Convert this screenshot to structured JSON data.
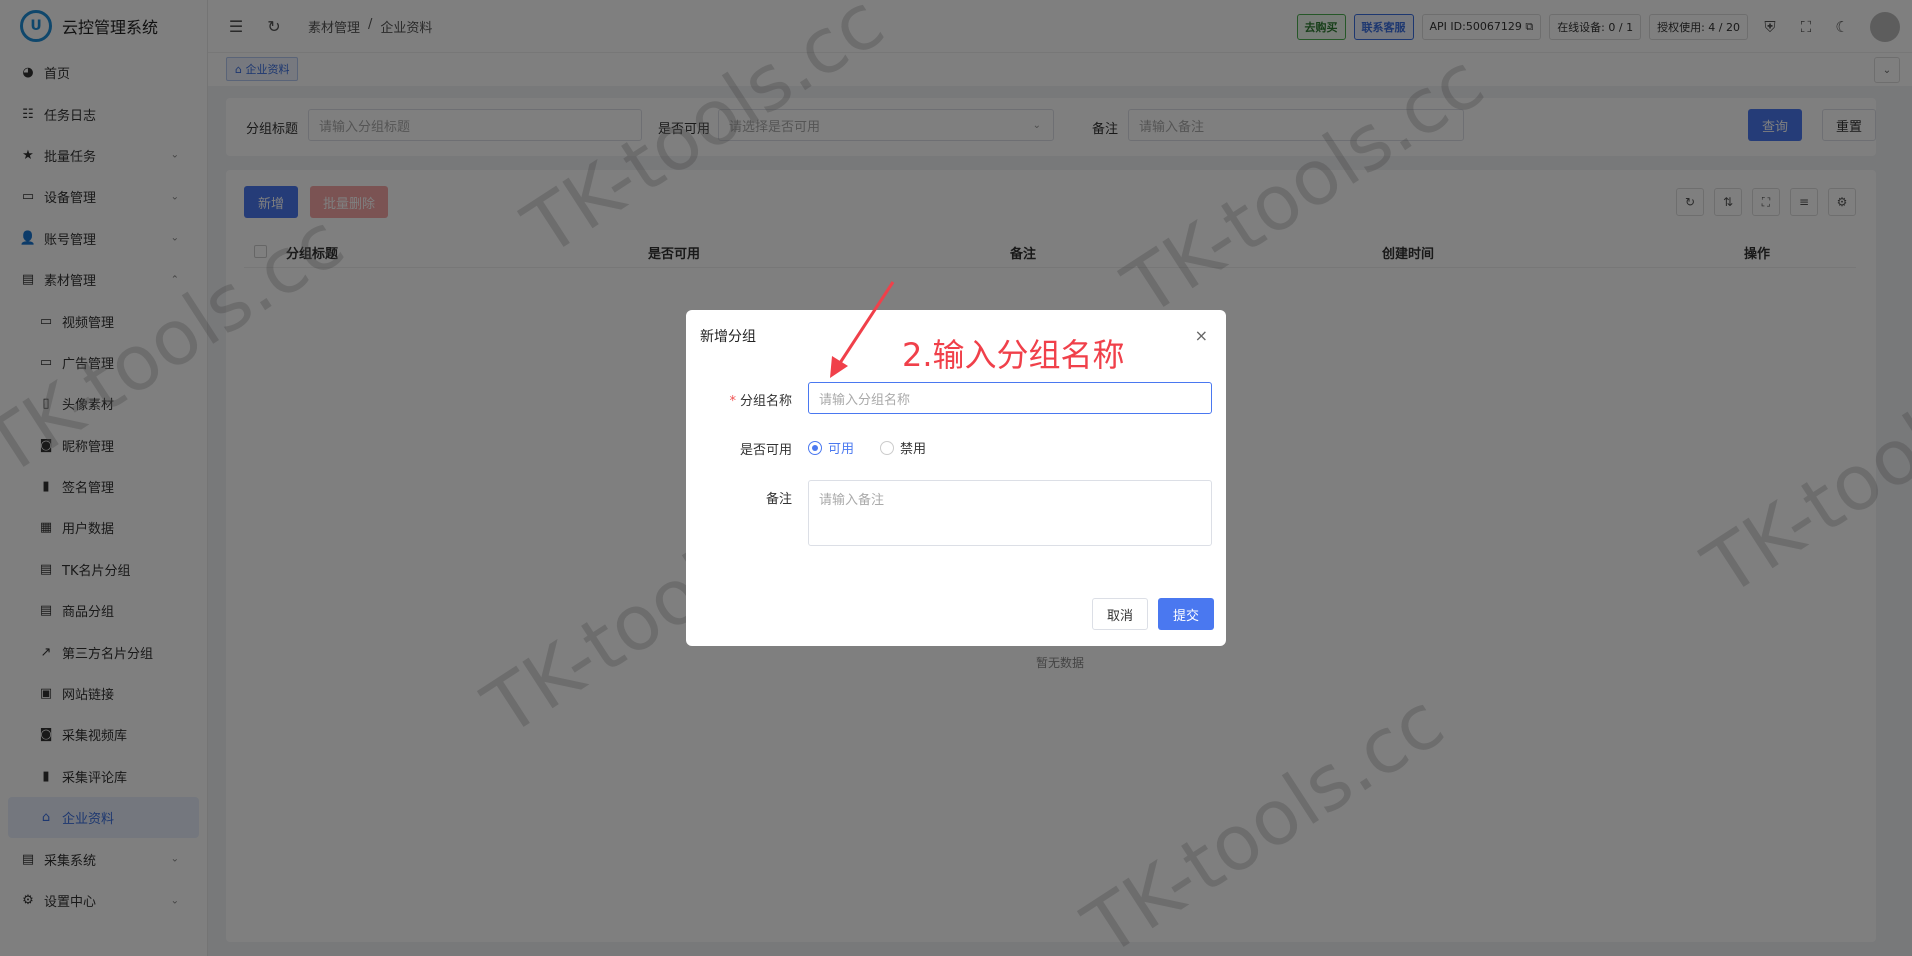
{
  "app": {
    "title": "云控管理系统",
    "logo_letter": "U"
  },
  "sidebar": {
    "items": [
      {
        "label": "首页",
        "icon": "dashboard-icon",
        "glyph": "◕"
      },
      {
        "label": "任务日志",
        "icon": "list-icon",
        "glyph": "☷"
      },
      {
        "label": "批量任务",
        "icon": "star-icon",
        "glyph": "★",
        "chevron": "⌄"
      },
      {
        "label": "设备管理",
        "icon": "monitor-icon",
        "glyph": "▭",
        "chevron": "⌄"
      },
      {
        "label": "账号管理",
        "icon": "users-icon",
        "glyph": "👤",
        "chevron": "⌄"
      },
      {
        "label": "素材管理",
        "icon": "document-icon",
        "glyph": "▤",
        "chevron": "⌃"
      }
    ],
    "sub_items": [
      {
        "label": "视频管理",
        "icon": "monitor-icon",
        "glyph": "▭"
      },
      {
        "label": "广告管理",
        "icon": "monitor-icon",
        "glyph": "▭"
      },
      {
        "label": "头像素材",
        "icon": "book-icon",
        "glyph": "▯"
      },
      {
        "label": "昵称管理",
        "icon": "badge-icon",
        "glyph": "◙"
      },
      {
        "label": "签名管理",
        "icon": "text-icon",
        "glyph": "▮"
      },
      {
        "label": "用户数据",
        "icon": "table-icon",
        "glyph": "▦"
      },
      {
        "label": "TK名片分组",
        "icon": "card-icon",
        "glyph": "▤"
      },
      {
        "label": "商品分组",
        "icon": "card-icon",
        "glyph": "▤"
      },
      {
        "label": "第三方名片分组",
        "icon": "external-link-icon",
        "glyph": "↗"
      },
      {
        "label": "网站链接",
        "icon": "image-icon",
        "glyph": "▣"
      },
      {
        "label": "采集视频库",
        "icon": "badge-icon",
        "glyph": "◙"
      },
      {
        "label": "采集评论库",
        "icon": "book-icon",
        "glyph": "▮"
      },
      {
        "label": "企业资料",
        "icon": "building-icon",
        "glyph": "⌂"
      }
    ],
    "bottom_items": [
      {
        "label": "采集系统",
        "icon": "document-icon",
        "glyph": "▤",
        "chevron": "⌄"
      },
      {
        "label": "设置中心",
        "icon": "gear-icon",
        "glyph": "⚙",
        "chevron": "⌄"
      }
    ]
  },
  "topbar": {
    "breadcrumb": [
      "素材管理",
      "/",
      "企业资料"
    ],
    "buy_label": "去购买",
    "support_label": "联系客服",
    "api_label": "API ID:50067129 ⧉",
    "online_label": "在线设备: 0 / 1",
    "license_label": "授权使用: 4 / 20"
  },
  "tags": {
    "active_tag": "⌂ 企业资料"
  },
  "search": {
    "group_title_label": "分组标题",
    "group_title_placeholder": "请输入分组标题",
    "available_label": "是否可用",
    "available_placeholder": "请选择是否可用",
    "remark_label": "备注",
    "remark_placeholder": "请输入备注",
    "query_button": "查询",
    "reset_button": "重置"
  },
  "table": {
    "add_button": "新增",
    "batch_delete_button": "批量删除",
    "columns": [
      "分组标题",
      "是否可用",
      "备注",
      "创建时间",
      "操作"
    ],
    "empty_text": "暂无数据"
  },
  "modal": {
    "title": "新增分组",
    "close": "×",
    "name_label": "分组名称",
    "required_mark": "*",
    "name_placeholder": "请输入分组名称",
    "available_label": "是否可用",
    "option_enabled": "可用",
    "option_disabled": "禁用",
    "remark_label": "备注",
    "remark_placeholder": "请输入备注",
    "cancel_button": "取消",
    "submit_button": "提交"
  },
  "annotation": {
    "text": "2.输入分组名称",
    "color": "#f0404a"
  },
  "watermark": {
    "text": "TK-tools.cc"
  },
  "colors": {
    "primary": "#4a78f0",
    "danger_light": "#f7a7a7",
    "overlay": "rgba(0,0,0,0.5)"
  }
}
